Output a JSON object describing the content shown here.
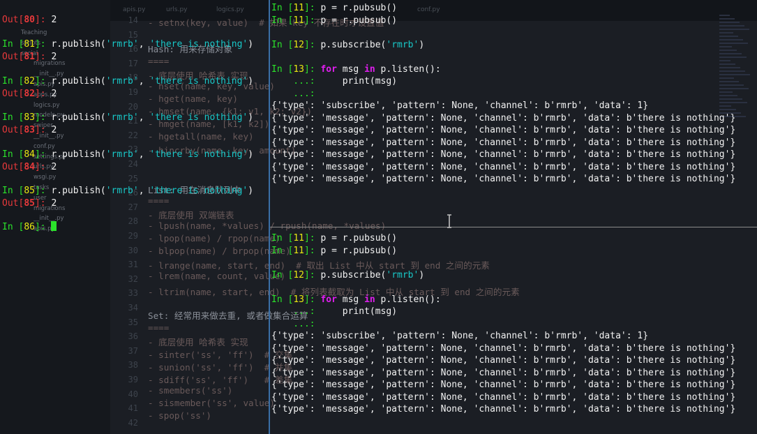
{
  "editor_ghost": {
    "tabs": [
      "apis.py",
      "urls.py",
      "logics.py",
      "conf.py"
    ],
    "sidebar": [
      "Teaching",
      "scripts",
      "social",
      "migrations",
      "__init__.py",
      "apis.py",
      "apps.py",
      "logics.py",
      "models.py",
      "swiper",
      "__init__.py",
      "conf.py",
      "settings.py",
      "urls.py",
      "wsgi.py",
      "tasks",
      "user",
      "migrations",
      "__init__.py",
      "apis.py"
    ],
    "line_numbers": [
      "14",
      "15",
      "16",
      "17",
      "18",
      "19",
      "20",
      "21",
      "22",
      "23",
      "24",
      "25",
      "26",
      "27",
      "28",
      "29",
      "30",
      "31",
      "32",
      "33",
      "34",
      "35",
      "36",
      "37",
      "38",
      "39",
      "40",
      "41",
      "42"
    ],
    "code": [
      "- setnx(key, value)  # 如果 key 不存在时才设置值",
      "Hash: 用来存储对象",
      "====",
      "- 底层使用 哈希表 实现",
      "- hset(name, key, value)",
      "- hget(name, key)",
      "- hmset(name, {k1: v1, k2: v2})",
      "- hmget(name, [k1, k2])",
      "- hgetall(name, key)",
      "- hincrby(name, key, amount)",
      "List: 用在消息队列中",
      "====",
      "- 底层使用 双端链表",
      "- lpush(name, *values) / rpush(name, *values)",
      "- lpop(name) / rpop(name)",
      "- blpop(name) / brpop(name)",
      "- lrange(name, start, end)  # 取出 List 中从 start 到 end 之间的元素",
      "- lrem(name, count, value)",
      "- ltrim(name, start, end)  # 将列表截取为 List 中从 start 到 end 之间的元素",
      "Set: 经常用来做去重, 或者做集合运算",
      "====",
      "- 底层使用 哈希表 实现",
      "- sinter('ss', 'ff')  # 交集",
      "- sunion('ss', 'ff')  # 并集",
      "- sdiff('ss', 'ff')   # 差集",
      "- smembers('ss')",
      "- sismember('ss', value)",
      "- spop('ss')"
    ]
  },
  "left_pane": {
    "first_out": {
      "label": "Out",
      "num": "80",
      "value": "2"
    },
    "blocks": [
      {
        "in_num": "81",
        "cmd": "r.publish(",
        "arg1": "'rmrb'",
        "sep": ", ",
        "arg2": "'there is nothing'",
        "close": ")",
        "out_num": "81",
        "out_val": "2"
      },
      {
        "in_num": "82",
        "cmd": "r.publish(",
        "arg1": "'rmrb'",
        "sep": ", ",
        "arg2": "'there is nothing'",
        "close": ")",
        "out_num": "82",
        "out_val": "2"
      },
      {
        "in_num": "83",
        "cmd": "r.publish(",
        "arg1": "'rmrb'",
        "sep": ", ",
        "arg2": "'there is nothing'",
        "close": ")",
        "out_num": "83",
        "out_val": "2"
      },
      {
        "in_num": "84",
        "cmd": "r.publish(",
        "arg1": "'rmrb'",
        "sep": ", ",
        "arg2": "'there is nothing'",
        "close": ")",
        "out_num": "84",
        "out_val": "2"
      },
      {
        "in_num": "85",
        "cmd": "r.publish(",
        "arg1": "'rmrb'",
        "sep": ", ",
        "arg2": "'there is nothing'",
        "close": ")",
        "out_num": "85",
        "out_val": "2"
      }
    ],
    "prompt_num": "86"
  },
  "right_pane": {
    "lines_pubsub": [
      {
        "num": "11",
        "code": "p = r.pubsub()"
      },
      {
        "num": "11",
        "code": "p = r.pubsub()"
      }
    ],
    "subscribe": {
      "num": "12",
      "pre": "p.subscribe(",
      "arg": "'rmrb'",
      "post": ")"
    },
    "loop": {
      "num": "13",
      "kw_for": "for",
      "var": " msg ",
      "kw_in": "in",
      "iter": " p.listen():"
    },
    "body": "print(msg)",
    "cont": "...:",
    "first_msg": "{'type': 'subscribe', 'pattern': None, 'channel': b'rmrb', 'data': 1}",
    "msg": "{'type': 'message', 'pattern': None, 'channel': b'rmrb', 'data': b'there is nothing'}",
    "msg_count": 6
  },
  "colors": {
    "prompt_green": "#2be22b",
    "number_yellow": "#e8e812",
    "string_cyan": "#18c8c8",
    "keyword_magenta": "#e01ef0",
    "out_red": "#e8393b"
  }
}
